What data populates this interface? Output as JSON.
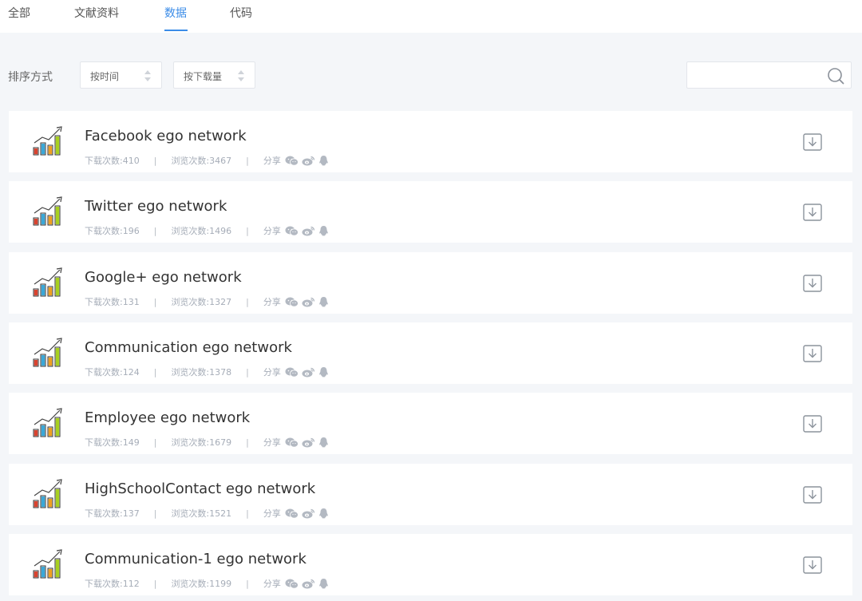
{
  "tabs": [
    {
      "label": "全部"
    },
    {
      "label": "文献资料"
    },
    {
      "label": "数据"
    },
    {
      "label": "代码"
    }
  ],
  "active_tab_index": 2,
  "sort": {
    "label": "排序方式",
    "by_time": "按时间",
    "by_downloads": "按下载量"
  },
  "search": {
    "placeholder": ""
  },
  "meta_labels": {
    "downloads": "下载次数:",
    "views": "浏览次数:",
    "separator": "|",
    "share": "分享"
  },
  "items": [
    {
      "title": "Facebook ego network",
      "downloads": "410",
      "views": "3467"
    },
    {
      "title": "Twitter ego network",
      "downloads": "196",
      "views": "1496"
    },
    {
      "title": "Google+ ego network",
      "downloads": "131",
      "views": "1327"
    },
    {
      "title": "Communication ego network",
      "downloads": "124",
      "views": "1378"
    },
    {
      "title": "Employee ego network",
      "downloads": "149",
      "views": "1679"
    },
    {
      "title": "HighSchoolContact ego network",
      "downloads": "137",
      "views": "1521"
    },
    {
      "title": "Communication-1 ego network",
      "downloads": "112",
      "views": "1199"
    }
  ],
  "colors": {
    "accent": "#3b8ce8",
    "background": "#f4f6f9",
    "card": "#ffffff",
    "meta_text": "#a6adb8",
    "bar_red": "#d9432f",
    "bar_blue": "#3aa8d8",
    "bar_orange": "#f0a020",
    "bar_green": "#a8d020"
  },
  "icons": {
    "item": "bar-chart-trend-icon",
    "download": "download-icon",
    "search": "search-icon",
    "share": [
      "wechat-icon",
      "weibo-icon",
      "qq-icon"
    ]
  }
}
